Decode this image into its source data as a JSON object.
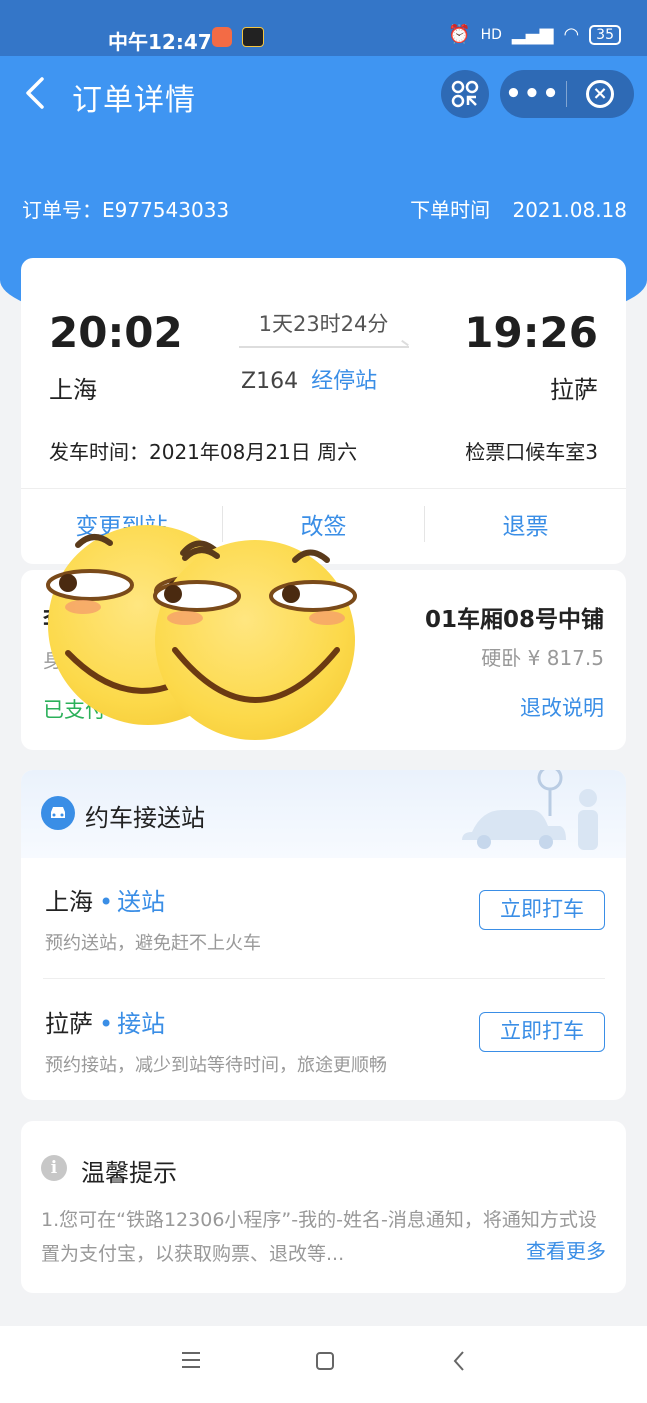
{
  "status_bar": {
    "time": "中午12:47",
    "network": "HD",
    "battery": "35"
  },
  "nav": {
    "title": "订单详情",
    "more_label": "•••",
    "close_label": "×"
  },
  "order": {
    "number_label": "订单号：E977543033",
    "time_label": "下单时间",
    "time_value": "2021.08.18"
  },
  "ticket": {
    "depart_time": "20:02",
    "depart_city": "上海",
    "duration": "1天23时24分",
    "train_no": "Z164",
    "stops_link": "经停站",
    "arrive_time": "19:26",
    "arrive_city": "拉萨",
    "depart_date": "发车时间：2021年08月21日 周六",
    "gate": "检票口候车室3",
    "actions": [
      "变更到站",
      "改签",
      "退票"
    ]
  },
  "passenger": {
    "name": "李",
    "id_type": "身",
    "status": "已支付",
    "seat": "01车厢08号中铺",
    "price": "硬卧 ¥ 817.5",
    "refund_rule": "退改说明"
  },
  "taxi": {
    "title": "约车接送站",
    "items": [
      {
        "city": "上海",
        "dot": "•",
        "tag": "送站",
        "desc": "预约送站，避免赶不上火车",
        "button": "立即打车"
      },
      {
        "city": "拉萨",
        "dot": "•",
        "tag": "接站",
        "desc": "预约接站，减少到站等待时间，旅途更顺畅",
        "button": "立即打车"
      }
    ]
  },
  "tips": {
    "icon": "i",
    "title": "温馨提示",
    "text": "1.您可在“铁路12306小程序”-我的-姓名-消息通知，将通知方式设置为支付宝，以获取购票、退改等...",
    "more": "查看更多"
  },
  "colors": {
    "brand_blue": "#3f95f2",
    "link_blue": "#3a8ee6",
    "paid_green": "#2bb05a"
  },
  "icons": [
    "back-icon",
    "scan-icon",
    "more-icon",
    "close-icon",
    "car-icon",
    "info-icon",
    "menu-icon",
    "home-icon",
    "nav-back-icon",
    "smiley-sticker"
  ]
}
